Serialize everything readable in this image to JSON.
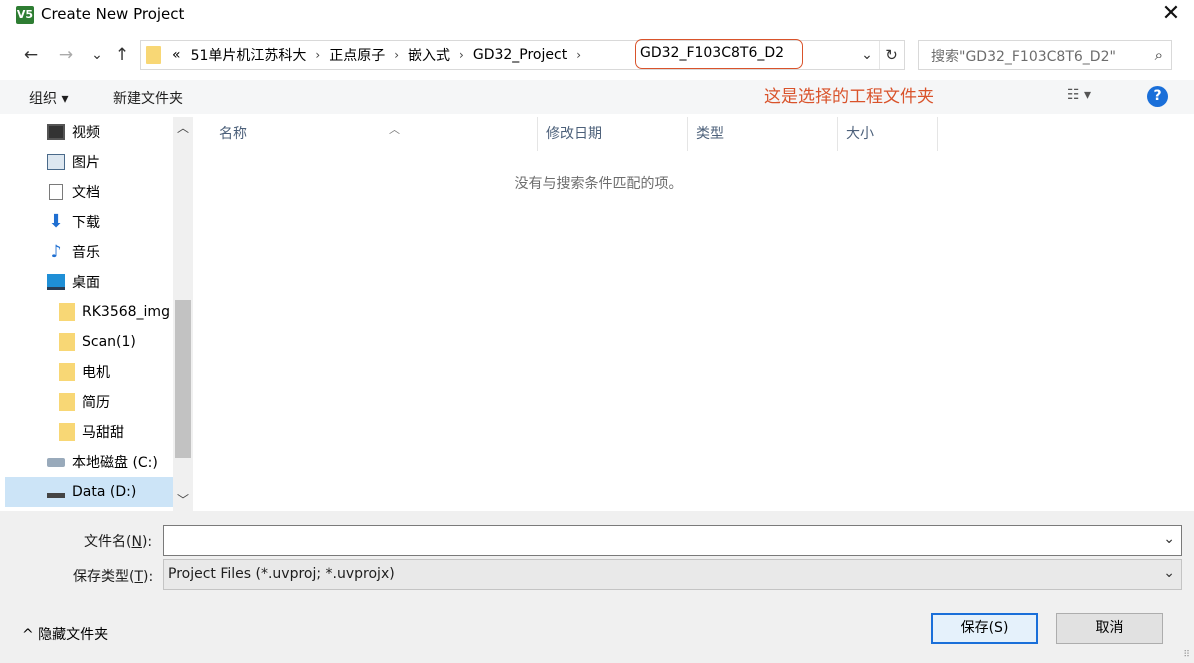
{
  "window": {
    "title": "Create New Project",
    "icon_text": "V5",
    "close_glyph": "✕"
  },
  "nav": {
    "back": "←",
    "forward": "→",
    "recent": "⌄",
    "up": "↑",
    "overflow": "«",
    "crumbs": [
      "51单片机江苏科大",
      "正点原子",
      "嵌入式",
      "GD32_Project"
    ],
    "current": "GD32_F103C8T6_D2",
    "refresh": "↻",
    "dropdown": "⌄"
  },
  "search": {
    "placeholder": "搜索\"GD32_F103C8T6_D2\"",
    "icon": "⌕"
  },
  "toolbar": {
    "organize": "组织 ▾",
    "new_folder": "新建文件夹",
    "annotation": "这是选择的工程文件夹",
    "view": "☷ ▾",
    "help": "?"
  },
  "sidebar": {
    "items": [
      {
        "label": "视频",
        "icon": "video-icon"
      },
      {
        "label": "图片",
        "icon": "picture-icon"
      },
      {
        "label": "文档",
        "icon": "document-icon"
      },
      {
        "label": "下载",
        "icon": "download-icon"
      },
      {
        "label": "音乐",
        "icon": "music-icon"
      },
      {
        "label": "桌面",
        "icon": "desktop-icon"
      },
      {
        "label": "RK3568_img",
        "icon": "folder-icon"
      },
      {
        "label": "Scan(1)",
        "icon": "folder-icon"
      },
      {
        "label": "电机",
        "icon": "folder-icon"
      },
      {
        "label": "简历",
        "icon": "folder-icon"
      },
      {
        "label": "马甜甜",
        "icon": "folder-icon"
      },
      {
        "label": "本地磁盘 (C:)",
        "icon": "drive-icon"
      },
      {
        "label": "Data (D:)",
        "icon": "drive-icon",
        "selected": true
      }
    ],
    "scroll_up": "︿",
    "scroll_down": "﹀"
  },
  "filelist": {
    "columns": [
      "名称",
      "修改日期",
      "类型",
      "大小"
    ],
    "sort_caret": "︿",
    "empty_message": "没有与搜索条件匹配的项。"
  },
  "form": {
    "filename_label": "文件名(",
    "filename_key": "N",
    "filename_label_end": "):",
    "filename_value": "",
    "filetype_label": "保存类型(",
    "filetype_key": "T",
    "filetype_label_end": "):",
    "filetype_value": "Project Files (*.uvproj; *.uvprojx)",
    "dropdown": "⌄"
  },
  "footer": {
    "hide_folders": "^ 隐藏文件夹",
    "save_label": "保存(S)",
    "cancel_label": "取消",
    "grip": "⠿"
  },
  "colors": {
    "accent": "#1a6fd9",
    "annotation": "#d9532b",
    "selected_bg": "#cce4f7"
  }
}
